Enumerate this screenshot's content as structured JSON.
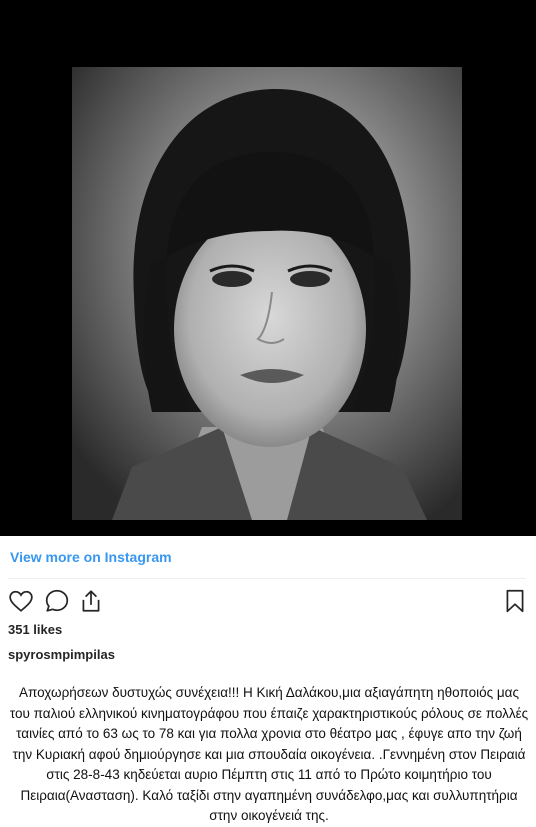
{
  "post": {
    "view_more_label": "View more on Instagram",
    "likes_text": "351 likes",
    "username": "spyrosmpimpilas",
    "caption": "Αποχωρήσεων δυστυχώς συνέχεια!!! Η Κική Δαλάκου,μια αξιαγάπητη ηθοποιός μας του παλιού ελληνικού κινηματογράφου που έπαιζε χαρακτηριστικούς ρόλους σε πολλές ταινίες από το 63 ως το 78 και για πολλα χρονια στο θέατρο μας , έφυγε απο την ζωή την Κυριακή αφού δημιούργησε και μια σπουδαία οικογένεια. .Γεννημένη στον Πειραιά στις 28-8-43 κηδεύεται αυριο Πέμπτη στις 11 από το Πρώτο κοιμητήριο του Πειραια(Ανασταση). Καλό ταξίδι στην αγαπημένη συνάδελφο,μας και συλλυπητήρια στην οικογένειά της."
  },
  "icons": {
    "like": "heart-icon",
    "comment": "comment-icon",
    "share": "share-icon",
    "save": "bookmark-icon"
  },
  "colors": {
    "link": "#3897f0",
    "text": "#262626",
    "media_background": "#000000"
  }
}
